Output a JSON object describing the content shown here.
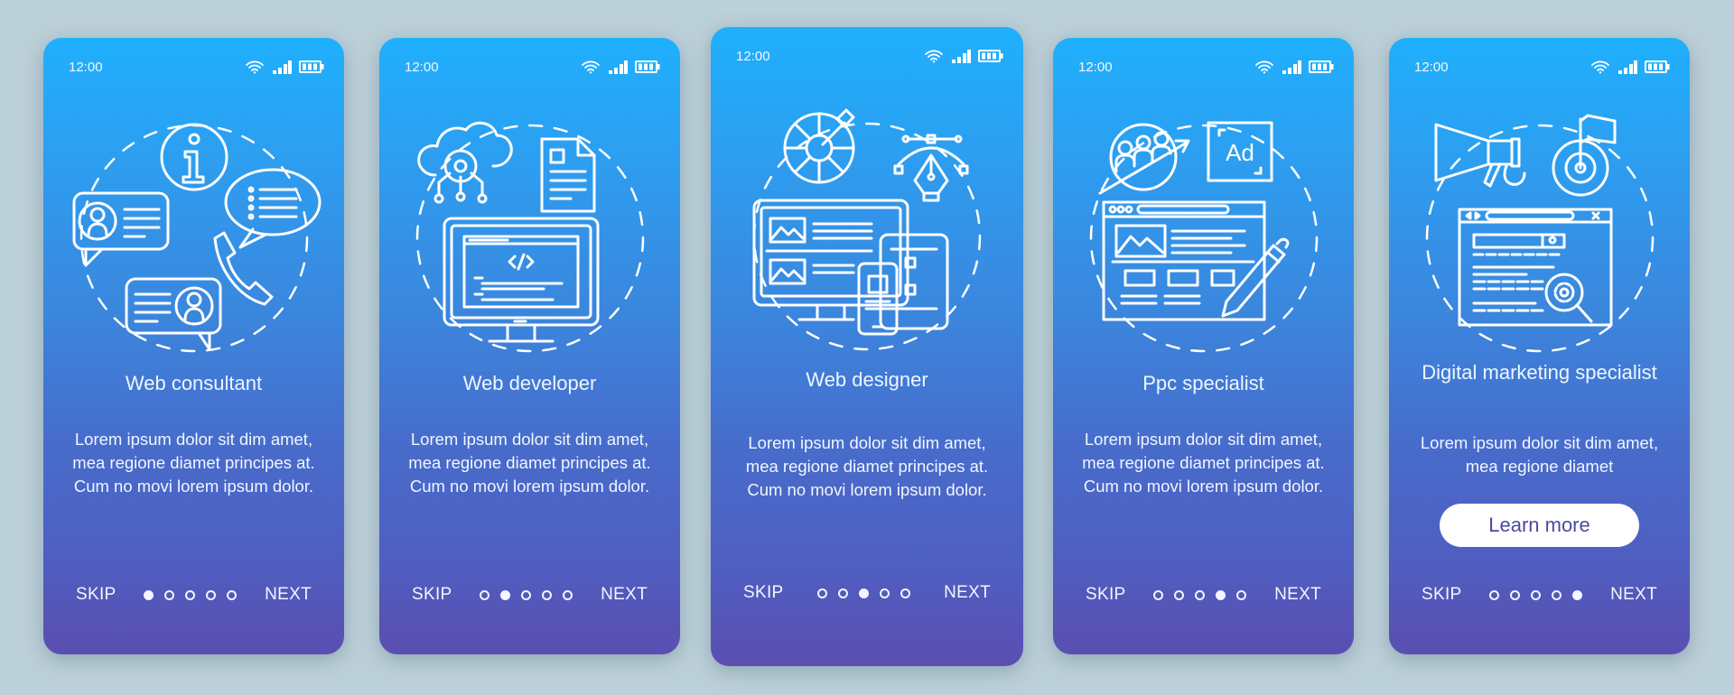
{
  "colors": {
    "background": "#bcd0d9",
    "gradient_top": "#1fb0fd",
    "gradient_bottom": "#5b4eb1",
    "button_text": "#4b4a9e"
  },
  "screens": [
    {
      "status": {
        "time": "12:00",
        "icons": [
          "wifi-icon",
          "signal-icon",
          "battery-icon"
        ]
      },
      "illustration": "web-consultant-illustration",
      "title": "Web consultant",
      "body": "Lorem ipsum dolor sit dim amet, mea regione diamet principes at. Cum no movi lorem ipsum dolor.",
      "skip_label": "SKIP",
      "next_label": "NEXT",
      "page_index": 1,
      "page_count": 5
    },
    {
      "status": {
        "time": "12:00",
        "icons": [
          "wifi-icon",
          "signal-icon",
          "battery-icon"
        ]
      },
      "illustration": "web-developer-illustration",
      "title": "Web developer",
      "body": "Lorem ipsum dolor sit dim amet, mea regione diamet principes at. Cum no movi lorem ipsum dolor.",
      "skip_label": "SKIP",
      "next_label": "NEXT",
      "page_index": 2,
      "page_count": 5
    },
    {
      "status": {
        "time": "12:00",
        "icons": [
          "wifi-icon",
          "signal-icon",
          "battery-icon"
        ]
      },
      "illustration": "web-designer-illustration",
      "title": "Web designer",
      "body": "Lorem ipsum dolor sit dim amet, mea regione diamet principes at. Cum no movi lorem ipsum dolor.",
      "skip_label": "SKIP",
      "next_label": "NEXT",
      "page_index": 3,
      "page_count": 5
    },
    {
      "status": {
        "time": "12:00",
        "icons": [
          "wifi-icon",
          "signal-icon",
          "battery-icon"
        ]
      },
      "illustration": "ppc-specialist-illustration",
      "illustration_badge": "Ad",
      "title": "Ppc specialist",
      "body": "Lorem ipsum dolor sit dim amet, mea regione diamet principes at. Cum no movi lorem ipsum dolor.",
      "skip_label": "SKIP",
      "next_label": "NEXT",
      "page_index": 4,
      "page_count": 5
    },
    {
      "status": {
        "time": "12:00",
        "icons": [
          "wifi-icon",
          "signal-icon",
          "battery-icon"
        ]
      },
      "illustration": "digital-marketing-illustration",
      "title": "Digital marketing specialist",
      "body": "Lorem ipsum dolor sit dim amet, mea regione diamet",
      "cta_label": "Learn more",
      "skip_label": "SKIP",
      "next_label": "NEXT",
      "page_index": 5,
      "page_count": 5
    }
  ]
}
